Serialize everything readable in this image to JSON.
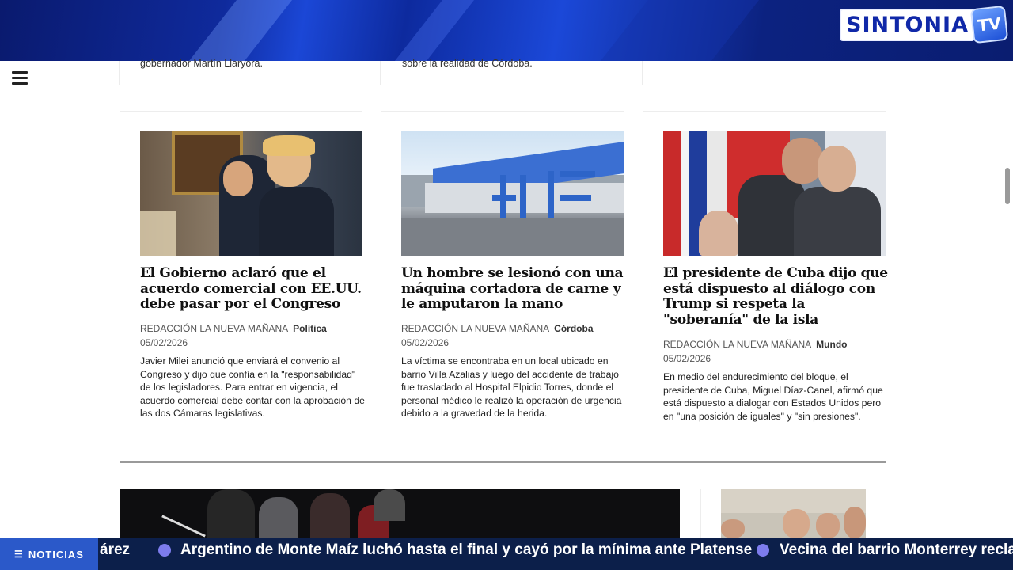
{
  "brand": {
    "logo_word": "SINTONIA",
    "logo_tv": "TV"
  },
  "prev_row": [
    {
      "excerpt_tail": "gobernador Martín Llaryora."
    },
    {
      "excerpt_tail": "sobre la realidad de Córdoba."
    },
    {
      "excerpt_tail": ""
    }
  ],
  "articles": [
    {
      "title": "El Gobierno aclaró que el acuerdo comercial con EE.UU. debe pasar por el Congreso",
      "author": "REDACCIÓN LA NUEVA MAÑANA",
      "section": "Política",
      "date": "05/02/2026",
      "excerpt": "Javier Milei anunció que enviará el convenio al Congreso y dijo que confía en la \"responsabilidad\" de los legisladores. Para entrar en vigencia, el acuerdo comercial debe contar con la aprobación de las dos Cámaras legislativas."
    },
    {
      "title": "Un hombre se lesionó con una máquina cortadora de carne y le amputaron la mano",
      "author": "REDACCIÓN LA NUEVA MAÑANA",
      "section": "Córdoba",
      "date": "05/02/2026",
      "excerpt": "La víctima se encontraba en un local ubicado en barrio Villa Azalias y luego del accidente de trabajo fue trasladado al Hospital Elpidio Torres, donde el personal médico le realizó la operación de urgencia debido a la gravedad de la herida."
    },
    {
      "title": "El presidente de Cuba dijo que está dispuesto al diálogo con Trump si respeta la \"soberanía\" de la isla",
      "author": "REDACCIÓN LA NUEVA MAÑANA",
      "section": "Mundo",
      "date": "05/02/2026",
      "excerpt": "En medio del endurecimiento del bloque, el presidente de Cuba, Miguel Díaz-Canel, afirmó que está dispuesto a dialogar con Estados Unidos pero en \"una posición de iguales\" y \"sin presiones\"."
    }
  ],
  "ticker": {
    "label": "NOTICIAS",
    "items": [
      "árez",
      "Argentino de Monte Maíz luchó hasta el final y cayó por la mínima ante Platense",
      "Vecina del barrio Monterrey reclam"
    ]
  },
  "colors": {
    "banner": "#0f2a9c",
    "ticker_bg": "#0c1f4a",
    "ticker_label_bg": "#2b59c9"
  }
}
